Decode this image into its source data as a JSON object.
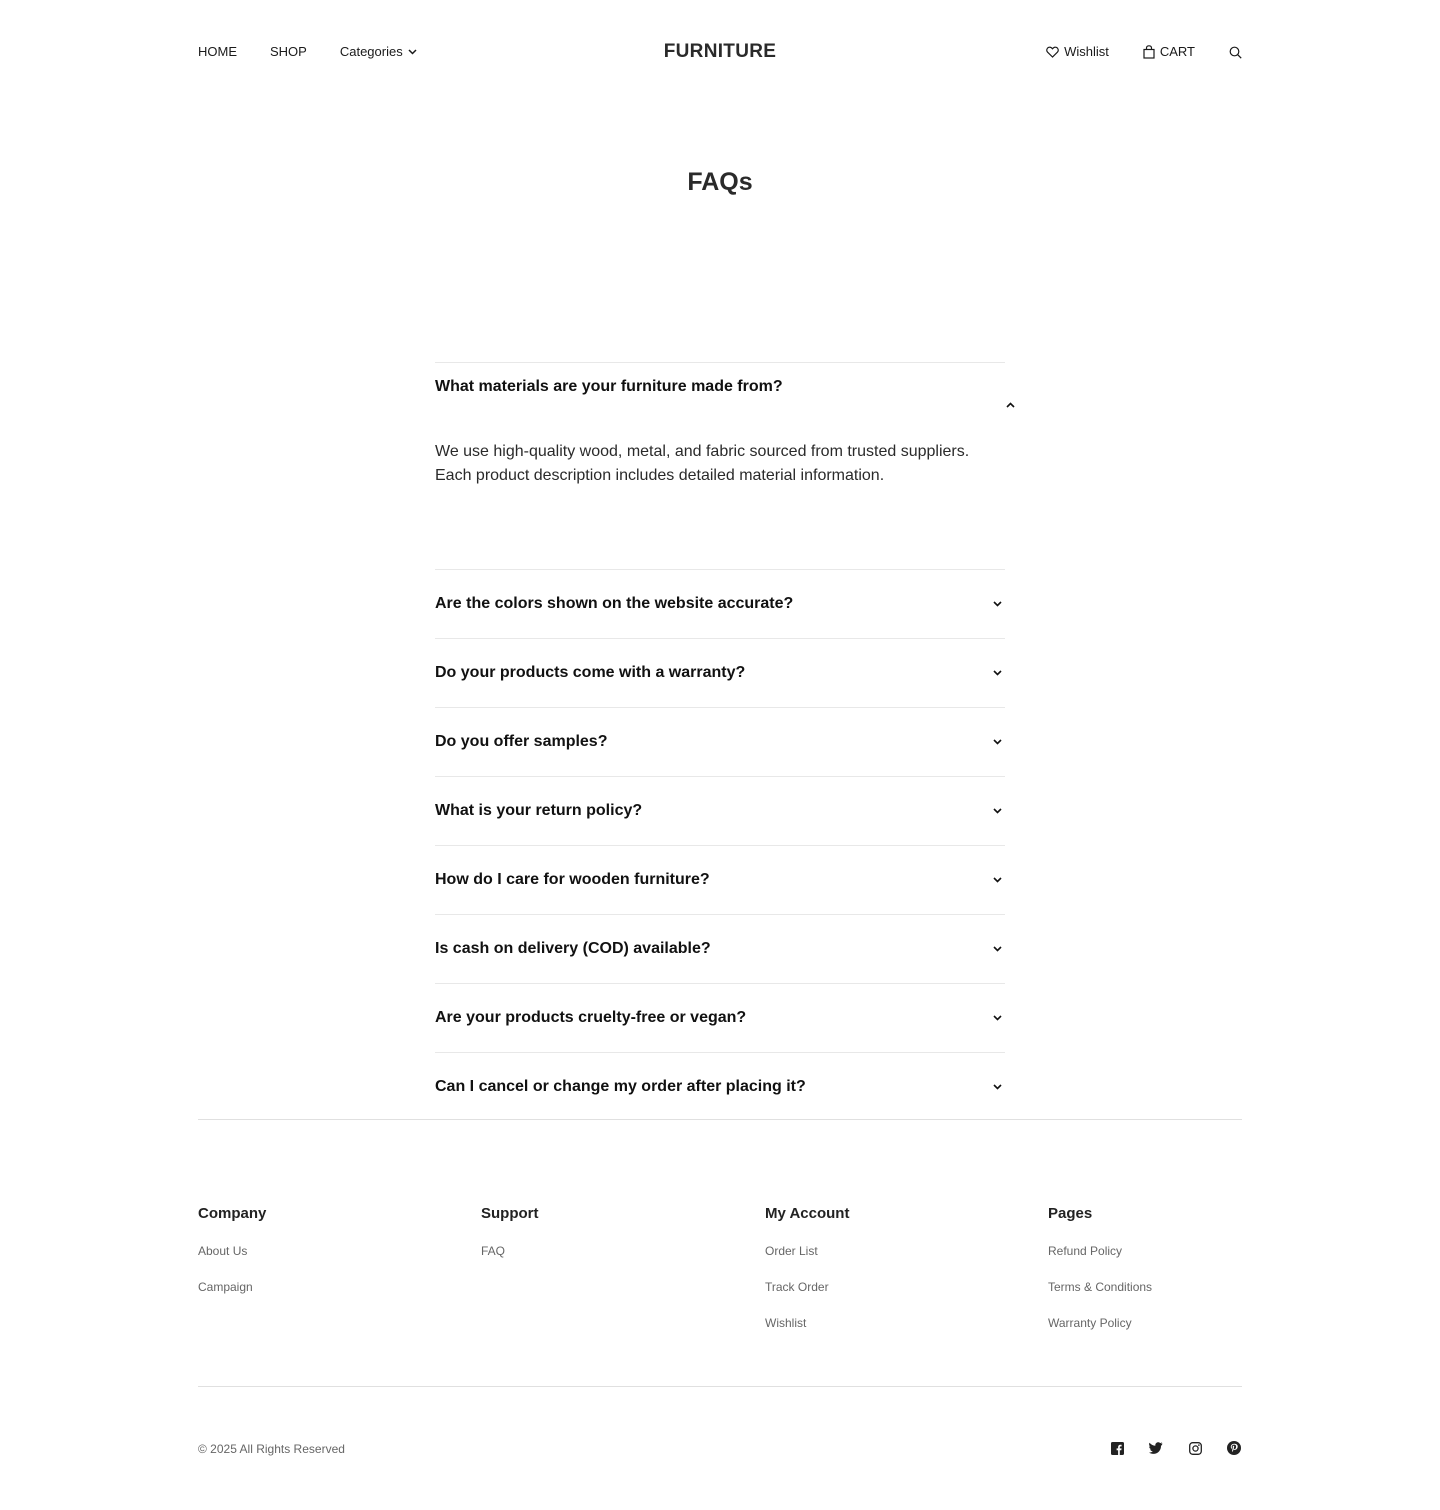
{
  "header": {
    "logo": "FURNITURE",
    "nav": {
      "home": "HOME",
      "shop": "SHOP",
      "categories": "Categories"
    },
    "wishlist": "Wishlist",
    "cart": "CART"
  },
  "page": {
    "title": "FAQs"
  },
  "faq": {
    "open": {
      "question": "What materials are your furniture made from?",
      "answer": "We use high-quality wood, metal, and fabric sourced from trusted suppliers. Each product description includes detailed material information."
    },
    "items": [
      "Are the colors shown on the website accurate?",
      "Do your products come with a warranty?",
      "Do you offer samples?",
      "What is your return policy?",
      "How do I care for wooden furniture?",
      "Is cash on delivery (COD) available?",
      "Are your products cruelty-free or vegan?",
      "Can I cancel or change my order after placing it?"
    ]
  },
  "footer": {
    "company": {
      "title": "Company",
      "links": [
        "About Us",
        "Campaign"
      ]
    },
    "support": {
      "title": "Support",
      "links": [
        "FAQ"
      ]
    },
    "account": {
      "title": "My Account",
      "links": [
        "Order List",
        "Track Order",
        "Wishlist"
      ]
    },
    "pages": {
      "title": "Pages",
      "links": [
        "Refund Policy",
        "Terms & Conditions",
        "Warranty Policy"
      ]
    },
    "copyright": "© 2025 All Rights Reserved",
    "social_icons": [
      "facebook-icon",
      "twitter-icon",
      "instagram-icon",
      "pinterest-icon"
    ]
  }
}
